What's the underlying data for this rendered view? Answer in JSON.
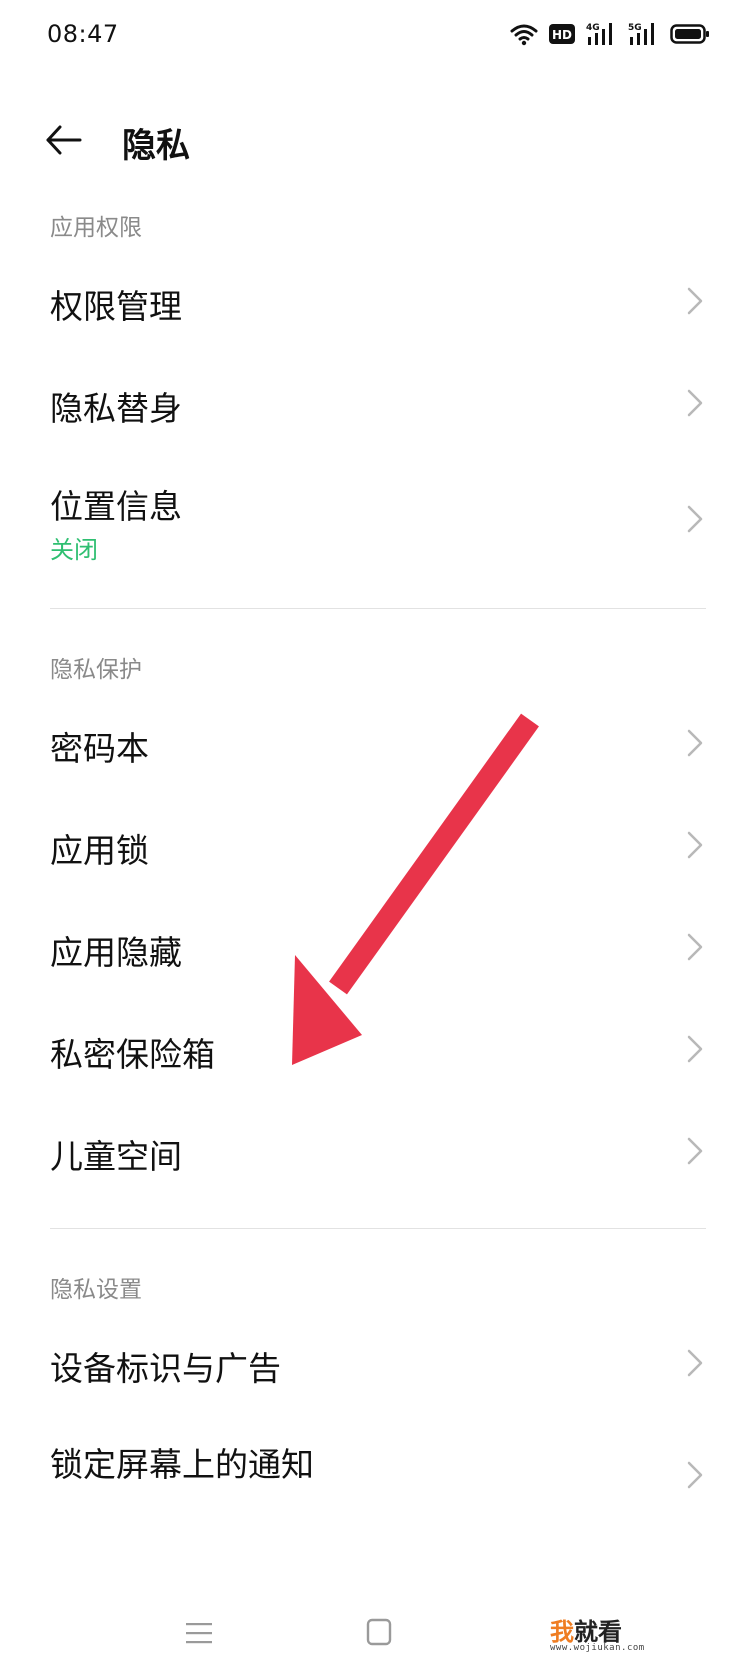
{
  "status_bar": {
    "time": "08:47",
    "icons": [
      "wifi-icon",
      "hd-icon",
      "signal-4g-icon",
      "signal-5g-icon",
      "battery-icon"
    ],
    "hd_label": "HD",
    "net1": "4G",
    "net2": "5G"
  },
  "header": {
    "back_icon": "back-arrow-icon",
    "title": "隐私"
  },
  "sections": {
    "permissions": {
      "label": "应用权限",
      "items": [
        {
          "label": "权限管理"
        },
        {
          "label": "隐私替身"
        },
        {
          "label": "位置信息",
          "status": "关闭"
        }
      ]
    },
    "protection": {
      "label": "隐私保护",
      "items": [
        {
          "label": "密码本"
        },
        {
          "label": "应用锁"
        },
        {
          "label": "应用隐藏"
        },
        {
          "label": "私密保险箱"
        },
        {
          "label": "儿童空间"
        }
      ]
    },
    "settings": {
      "label": "隐私设置",
      "items": [
        {
          "label": "设备标识与广告"
        },
        {
          "label": "锁定屏幕上的通知"
        }
      ]
    }
  },
  "nav_bar": {
    "icons": [
      "menu-icon",
      "home-icon"
    ]
  },
  "watermark": {
    "part1": "我",
    "part2": "就看",
    "url": "www.wojiukan.com"
  },
  "colors": {
    "accent_green": "#2fbf71",
    "arrow_red": "#e8344a",
    "section_gray": "#8a8a8a"
  }
}
